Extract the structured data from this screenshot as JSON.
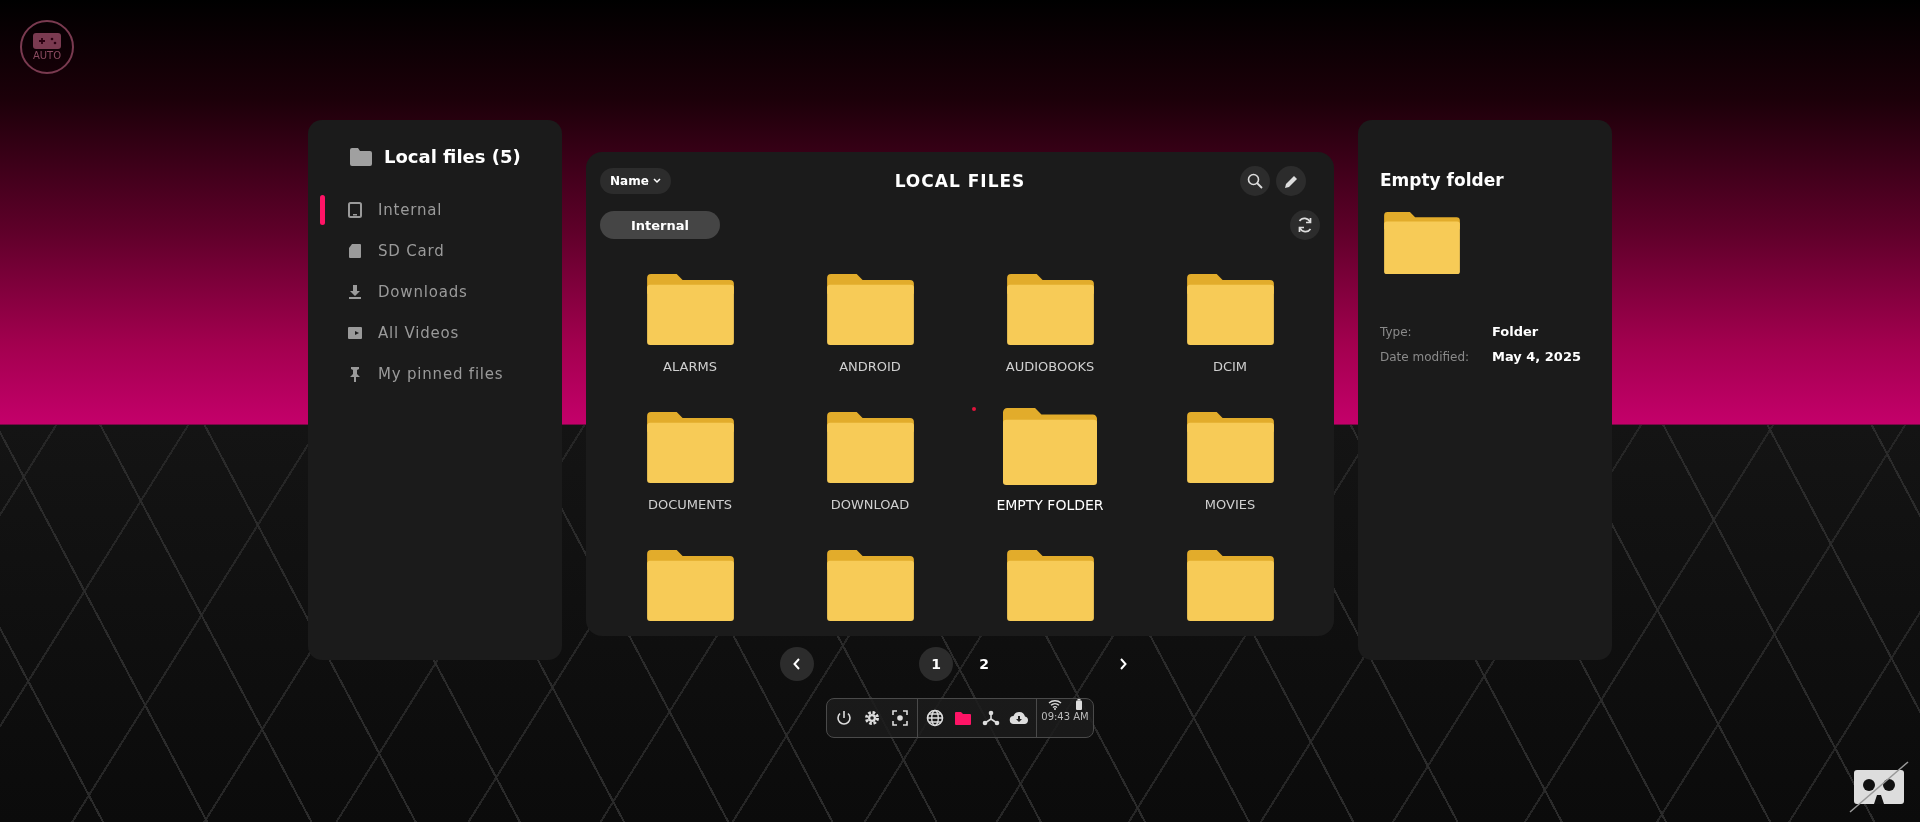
{
  "mode_badge": {
    "label": "AUTO"
  },
  "sidebar": {
    "title": "Local files (5)",
    "items": [
      {
        "label": "Internal",
        "selected": true
      },
      {
        "label": "SD Card",
        "selected": false
      },
      {
        "label": "Downloads",
        "selected": false
      },
      {
        "label": "All Videos",
        "selected": false
      },
      {
        "label": "My pinned files",
        "selected": false
      }
    ]
  },
  "browser": {
    "sort": {
      "label": "Name"
    },
    "title": "LOCAL FILES",
    "storage_chip": {
      "label": "Internal"
    },
    "folders": [
      {
        "name": "ALARMS",
        "selected": false
      },
      {
        "name": "ANDROID",
        "selected": false
      },
      {
        "name": "AUDIOBOOKS",
        "selected": false
      },
      {
        "name": "DCIM",
        "selected": false
      },
      {
        "name": "DOCUMENTS",
        "selected": false
      },
      {
        "name": "DOWNLOAD",
        "selected": false
      },
      {
        "name": "EMPTY FOLDER",
        "selected": true
      },
      {
        "name": "MOVIES",
        "selected": false
      },
      {
        "selected": false
      },
      {
        "selected": false
      },
      {
        "selected": false
      },
      {
        "selected": false
      }
    ]
  },
  "details": {
    "title": "Empty folder",
    "properties": [
      {
        "label": "Type:",
        "value": "Folder"
      },
      {
        "label": "Date modified:",
        "value": "May 4, 2025"
      }
    ]
  },
  "pagination": {
    "pages": [
      {
        "label": "1",
        "selected": true
      },
      {
        "label": "2",
        "selected": false
      }
    ]
  },
  "dock": {
    "apps": [
      {
        "selected": false
      },
      {
        "selected": true
      },
      {
        "selected": false
      },
      {
        "selected": false
      }
    ],
    "time": "09:43 AM"
  }
}
